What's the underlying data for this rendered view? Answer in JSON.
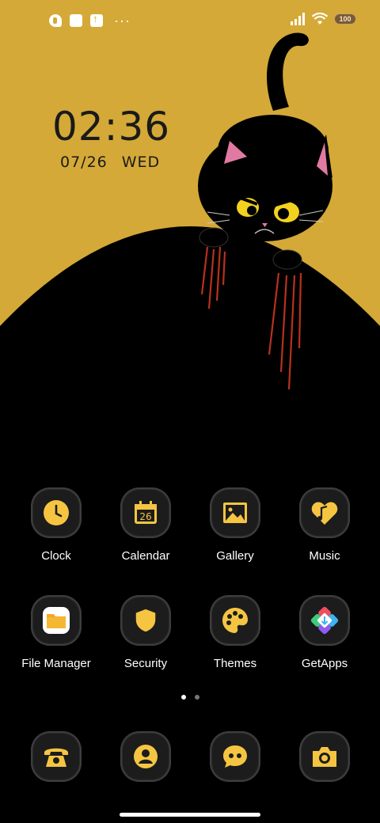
{
  "status_bar": {
    "battery_level": "100",
    "notification_icons": [
      "app-notification-icon",
      "square-notification-icon",
      "upload-notification-icon"
    ],
    "overflow": "···"
  },
  "clock_widget": {
    "time": "02:36",
    "date": "07/26",
    "weekday": "WED"
  },
  "apps": [
    {
      "label": "Clock",
      "icon": "clock-icon"
    },
    {
      "label": "Calendar",
      "icon": "calendar-icon",
      "icon_text": "26"
    },
    {
      "label": "Gallery",
      "icon": "gallery-icon"
    },
    {
      "label": "Music",
      "icon": "music-icon"
    },
    {
      "label": "File Manager",
      "icon": "folder-icon"
    },
    {
      "label": "Security",
      "icon": "shield-icon"
    },
    {
      "label": "Themes",
      "icon": "palette-icon"
    },
    {
      "label": "GetApps",
      "icon": "getapps-icon"
    }
  ],
  "dock": [
    {
      "icon": "phone-icon"
    },
    {
      "icon": "contacts-icon"
    },
    {
      "icon": "messages-icon"
    },
    {
      "icon": "camera-icon"
    }
  ],
  "pager": {
    "pages": 2,
    "current": 1
  },
  "colors": {
    "wallpaper_yellow": "#D4A937",
    "icon_accent": "#F5C542",
    "background": "#000000"
  }
}
